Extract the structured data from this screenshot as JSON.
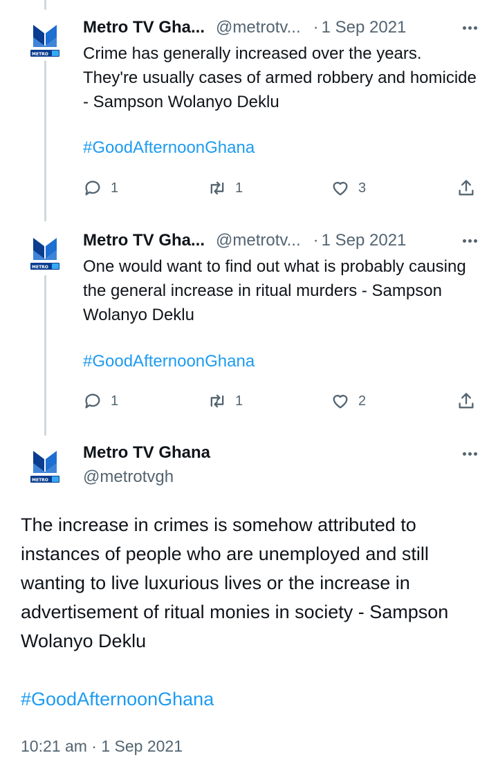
{
  "tweets": [
    {
      "name": "Metro TV Gha...",
      "handle": "@metrotv...",
      "separator": "·",
      "date": "1 Sep 2021",
      "text": "Crime has generally increased over the years. They're usually cases of armed robbery and homicide - Sampson Wolanyo Deklu",
      "hashtag": "#GoodAfternoonGhana",
      "replies": "1",
      "retweets": "1",
      "likes": "3"
    },
    {
      "name": "Metro TV Gha...",
      "handle": "@metrotv...",
      "separator": "·",
      "date": "1 Sep 2021",
      "text": "One would want to find out what is probably causing the general increase in ritual murders - Sampson Wolanyo Deklu",
      "hashtag": "#GoodAfternoonGhana",
      "replies": "1",
      "retweets": "1",
      "likes": "2"
    }
  ],
  "main_tweet": {
    "name": "Metro TV Ghana",
    "handle": "@metrotvgh",
    "text": "The increase in crimes is somehow attributed to instances of people who are unemployed and still wanting to live luxurious lives or the increase in advertisement of ritual monies in society - Sampson Wolanyo Deklu",
    "hashtag": "#GoodAfternoonGhana",
    "timestamp": "10:21 am · 1 Sep 2021"
  },
  "avatar_text": "METRO TV",
  "colors": {
    "brand_blue": "#1d6fd1",
    "brand_dark": "#0a3d8f",
    "link": "#1d9bf0",
    "secondary_text": "#536471",
    "thread_line": "#cfd9de"
  },
  "icons": [
    "reply-icon",
    "retweet-icon",
    "like-icon",
    "share-icon",
    "more-icon"
  ]
}
